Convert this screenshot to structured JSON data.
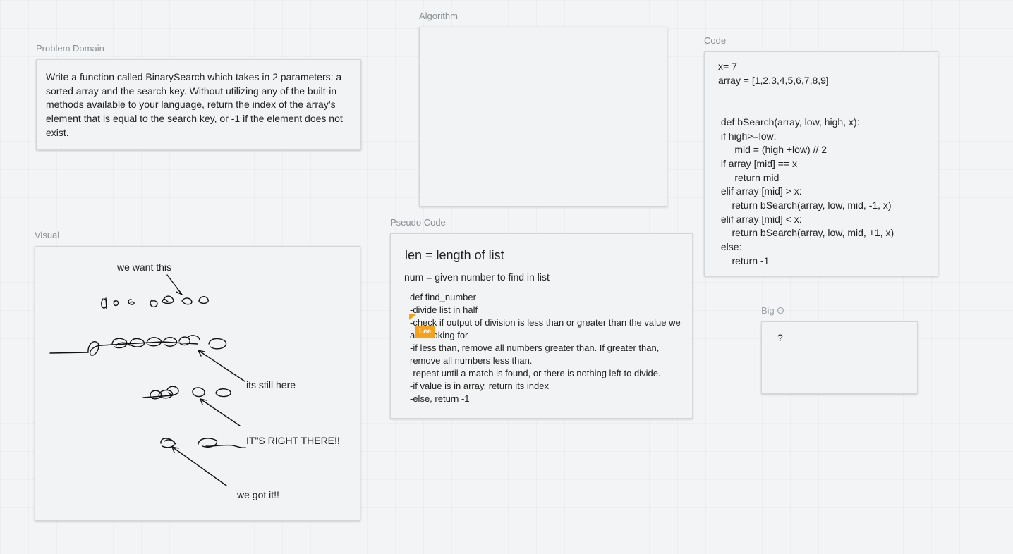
{
  "frames": {
    "problem_domain": {
      "title": "Problem Domain",
      "body": "Write a function called BinarySearch which takes in 2 parameters: a sorted array and the search key. Without utilizing any of the built-in methods available to your language, return the index of the array’s element that is equal to the search key, or -1 if the element does not exist."
    },
    "algorithm": {
      "title": "Algorithm"
    },
    "code": {
      "title": "Code",
      "lines": [
        "x= 7",
        "array = [1,2,3,4,5,6,7,8,9]",
        "",
        "",
        " def bSearch(array, low, high, x):",
        " if high>=low:",
        "      mid = (high +low) // 2",
        " if array [mid] == x",
        "      return mid",
        " elif array [mid] > x:",
        "     return bSearch(array, low, mid, -1, x)",
        " elif array [mid] < x:",
        "     return bSearch(array, low, mid, +1, x)",
        " else:",
        "     return -1"
      ]
    },
    "pseudo_code": {
      "title": "Pseudo Code",
      "heading": "len = length of list",
      "subheading": "num = given number to find in list",
      "lines": [
        "def find_number",
        "-divide list in half",
        "-check if output of division is less than or greater than the value we",
        "are looking for",
        "-if less than, remove all numbers greater than. If greater than,",
        "remove all numbers less than.",
        "-repeat until a match is found, or there is nothing left to divide.",
        "-if value is in array, return its index",
        "-else, return -1"
      ]
    },
    "big_o": {
      "title": "Big O",
      "body": "?"
    },
    "visual": {
      "title": "Visual",
      "notes": {
        "want": "we want this",
        "still": "its still here",
        "right_there": "IT\"S RIGHT THERE!!",
        "got_it": "we got it!!"
      }
    }
  },
  "collaborator": {
    "name": "Lee",
    "color": "#f5a21a"
  }
}
